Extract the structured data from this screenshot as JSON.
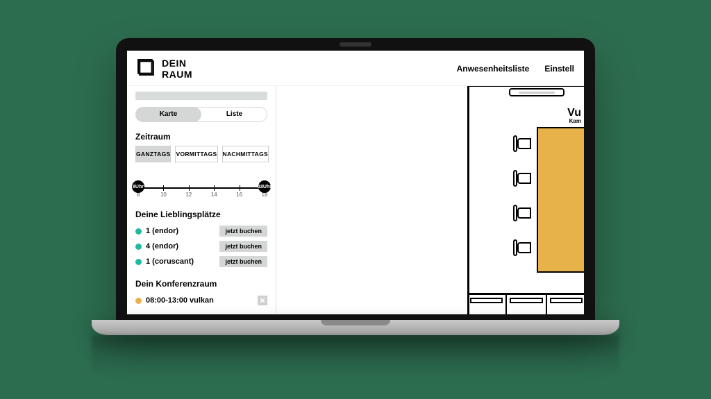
{
  "brand": {
    "line1": "DEIN",
    "line2": "RAUM"
  },
  "nav": {
    "attendance": "Anwesenheitsliste",
    "settings": "Einstell"
  },
  "viewToggle": {
    "card": "Karte",
    "list": "Liste"
  },
  "period": {
    "heading": "Zeitraum",
    "allday": "GANZTAGS",
    "morning": "VORMITTAGS",
    "afternoon": "NACHMITTAGS"
  },
  "slider": {
    "startLabel": "8Uhr",
    "endLabel": "18Uhr",
    "ticks": [
      "8",
      "10",
      "12",
      "14",
      "16",
      "18"
    ]
  },
  "favorites": {
    "heading": "Deine Lieblingsplätze",
    "bookLabel": "jetzt buchen",
    "items": [
      {
        "name": "1 (endor)"
      },
      {
        "name": "4 (endor)"
      },
      {
        "name": "1 (coruscant)"
      }
    ]
  },
  "conference": {
    "heading": "Dein Konferenzraum",
    "item": "08:00-13:00 vulkan"
  },
  "plan": {
    "roomTitle": "Vu",
    "roomSub": "Kam"
  }
}
